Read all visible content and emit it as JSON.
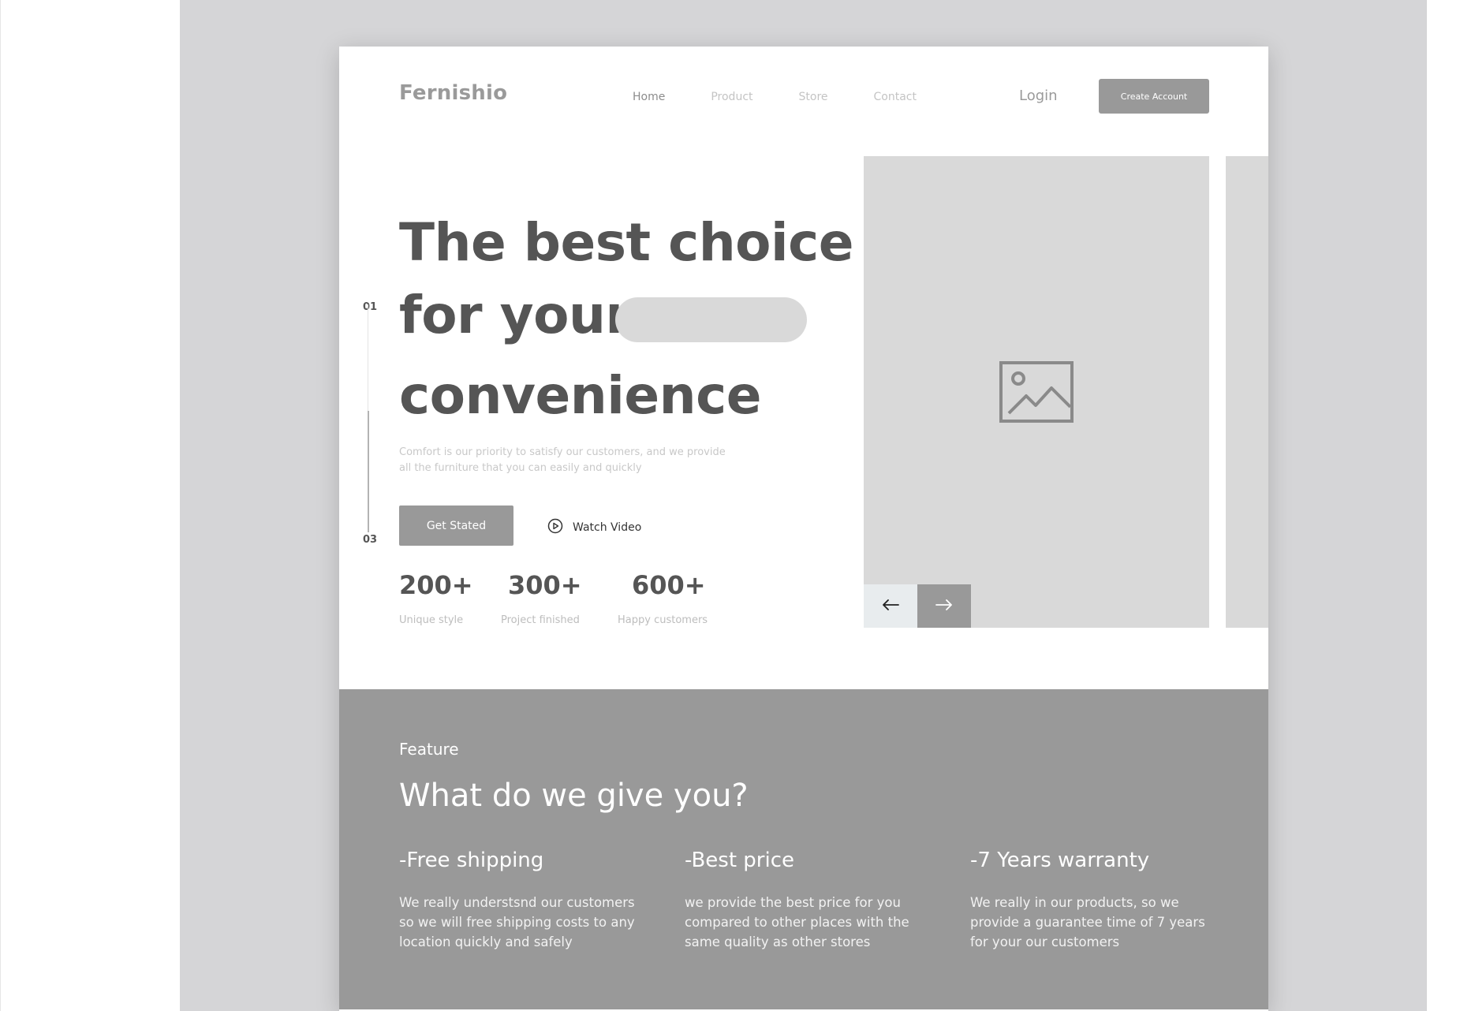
{
  "brand": {
    "logo": "Fernishio"
  },
  "nav": {
    "items": [
      {
        "label": "Home",
        "active": true
      },
      {
        "label": "Product",
        "active": false
      },
      {
        "label": "Store",
        "active": false
      },
      {
        "label": "Contact",
        "active": false
      }
    ],
    "login_label": "Login",
    "create_account_label": "Create Account"
  },
  "hero": {
    "slide_start": "01",
    "slide_end": "03",
    "headline_line1": "The best choice",
    "headline_line2": "for your",
    "headline_line3": "convenience",
    "subtitle": "Comfort is our priority to satisfy our customers, and we provide all the furniture that you can easily and quickly",
    "cta_label": "Get Stated",
    "watch_label": "Watch Video",
    "stats": [
      {
        "value": "200+",
        "label": "Unique style"
      },
      {
        "value": "300+",
        "label": "Project finished"
      },
      {
        "value": "600+",
        "label": "Happy customers"
      }
    ],
    "image_icon": "image-placeholder-icon",
    "prev_icon": "arrow-left-icon",
    "next_icon": "arrow-right-icon"
  },
  "feature": {
    "eyebrow": "Feature",
    "title": "What do we give you?",
    "items": [
      {
        "title": "-Free shipping",
        "desc": "We really understsnd our customers so we will free shipping costs to any location quickly and safely"
      },
      {
        "title": "-Best price",
        "desc": "we provide the best price for you compared to other places with the same quality as other stores"
      },
      {
        "title": "-7 Years warranty",
        "desc": "We really in our products, so we provide a guarantee time of 7 years for your our customers"
      }
    ]
  },
  "colors": {
    "canvas": "#d5d5d7",
    "accent_gray": "#999999",
    "heading": "#555555",
    "placeholder": "#d9d9d9"
  }
}
